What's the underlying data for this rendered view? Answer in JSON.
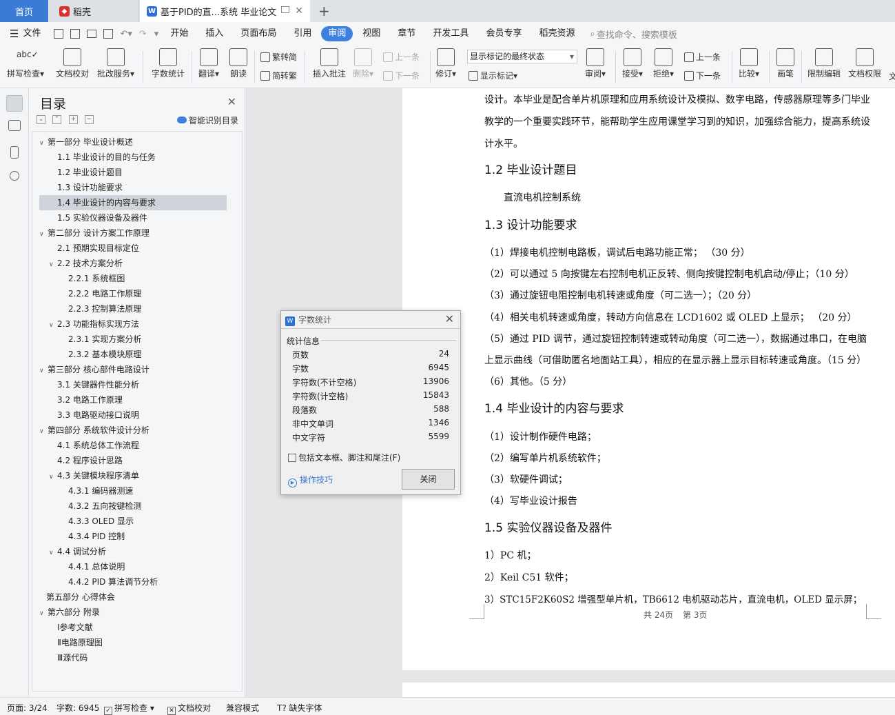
{
  "tabs": {
    "home": "首页",
    "dk": "稻壳",
    "doc": "基于PID的直...系统 毕业论文"
  },
  "menu": {
    "file": "文件",
    "items": [
      "开始",
      "插入",
      "页面布局",
      "引用",
      "审阅",
      "视图",
      "章节",
      "开发工具",
      "会员专享",
      "稻壳资源"
    ],
    "search": "查找命令、搜索模板"
  },
  "ribbon": {
    "spell": "拼写检查",
    "proof": "文档校对",
    "annot": "批改服务",
    "count": "字数统计",
    "translate": "翻译",
    "read": "朗读",
    "to_trad": "繁转简",
    "to_simp": "简转繁",
    "insert_comment": "插入批注",
    "delete": "删除",
    "prev": "上一条",
    "next": "下一条",
    "revise": "修订",
    "markup_select": "显示标记的最终状态",
    "show_markup": "显示标记",
    "review": "审阅",
    "accept": "接受",
    "reject": "拒绝",
    "prev2": "上一条",
    "next2": "下一条",
    "compare": "比较",
    "pen": "画笔",
    "restrict": "限制编辑",
    "perm": "文档权限",
    "more": "文"
  },
  "toc": {
    "title": "目录",
    "smart": "智能识别目录",
    "items": [
      {
        "label": "第一部分  毕业设计概述",
        "tri": "∨"
      },
      {
        "label": "1.1  毕业设计的目的与任务",
        "tri": ""
      },
      {
        "label": "1.2  毕业设计题目",
        "tri": ""
      },
      {
        "label": "1.3  设计功能要求",
        "tri": ""
      },
      {
        "label": "1.4  毕业设计的内容与要求",
        "tri": ""
      },
      {
        "label": "1.5  实验仪器设备及器件",
        "tri": ""
      },
      {
        "label": "第二部分  设计方案工作原理",
        "tri": "∨"
      },
      {
        "label": "2.1  预期实现目标定位",
        "tri": ""
      },
      {
        "label": "2.2  技术方案分析",
        "tri": "∨"
      },
      {
        "label": "2.2.1 系统框图",
        "tri": ""
      },
      {
        "label": "2.2.2 电路工作原理",
        "tri": ""
      },
      {
        "label": "2.2.3 控制算法原理",
        "tri": ""
      },
      {
        "label": "2.3  功能指标实现方法",
        "tri": "∨"
      },
      {
        "label": "2.3.1  实现方案分析",
        "tri": ""
      },
      {
        "label": "2.3.2  基本模块原理",
        "tri": ""
      },
      {
        "label": "第三部分  核心部件电路设计",
        "tri": "∨"
      },
      {
        "label": "3.1  关键器件性能分析",
        "tri": ""
      },
      {
        "label": "3.2  电路工作原理",
        "tri": ""
      },
      {
        "label": "3.3  电路驱动接口说明",
        "tri": ""
      },
      {
        "label": "第四部分  系统软件设计分析",
        "tri": "∨"
      },
      {
        "label": "4.1  系统总体工作流程",
        "tri": ""
      },
      {
        "label": "4.2  程序设计思路",
        "tri": ""
      },
      {
        "label": "4.3  关键模块程序清单",
        "tri": "∨"
      },
      {
        "label": "4.3.1 编码器测速",
        "tri": ""
      },
      {
        "label": "4.3.2 五向按键检测",
        "tri": ""
      },
      {
        "label": "4.3.3 OLED 显示",
        "tri": ""
      },
      {
        "label": "4.3.4 PID 控制",
        "tri": ""
      },
      {
        "label": "4.4  调试分析",
        "tri": "∨"
      },
      {
        "label": "4.4.1  总体说明",
        "tri": ""
      },
      {
        "label": "4.4.2 PID 算法调节分析",
        "tri": ""
      },
      {
        "label": "第五部分  心得体会",
        "tri": ""
      },
      {
        "label": "第六部分  附录",
        "tri": "∨"
      },
      {
        "label": "Ⅰ参考文献",
        "tri": ""
      },
      {
        "label": "Ⅱ电路原理图",
        "tri": ""
      },
      {
        "label": "Ⅲ源代码",
        "tri": ""
      }
    ]
  },
  "doc": {
    "lines": [
      "设计。本毕业是配合单片机原理和应用系统设计及模拟、数字电路，传感器原理等多门毕业",
      "教学的一个重要实践环节，能帮助学生应用课堂学习到的知识，加强综合能力，提高系统设",
      "计水平。"
    ],
    "h12": "1.2  毕业设计题目",
    "topic": "直流电机控制系统",
    "h13": "1.3  设计功能要求",
    "req": [
      "（1）焊接电机控制电路板，调试后电路功能正常；  （30 分）",
      "（2）可以通过  5  向按键左右控制电机正反转、侧向按键控制电机启动/停止；（10 分）",
      "（3）通过旋钮电阻控制电机转速或角度（可二选一）；（20 分）",
      "（4）相关电机转速或角度，转动方向信息在  LCD1602  或  OLED  上显示；  （20 分）",
      "（5）通过  PID  调节，通过旋钮控制转速或转动角度（可二选一），数据通过串口，在电脑",
      "上显示曲线（可借助匿名地面站工具），相应的在显示器上显示目标转速或角度。（15 分）",
      "（6）其他。（5 分）"
    ],
    "h14": "1.4  毕业设计的内容与要求",
    "content": [
      "（1）设计制作硬件电路；",
      "（2）编写单片机系统软件；",
      "（3）软硬件调试；",
      "（4）写毕业设计报告"
    ],
    "h15": "1.5  实验仪器设备及器件",
    "equip": [
      "1）PC 机；",
      "2）Keil C51 软件；",
      "3）STC15F2K60S2 增强型单片机，TB6612 电机驱动芯片，直流电机，OLED 显示屏；"
    ],
    "footer_total": "共 24页",
    "footer_page": "第 3页"
  },
  "dialog": {
    "title": "字数统计",
    "group": "统计信息",
    "stats": [
      {
        "label": "页数",
        "value": "24"
      },
      {
        "label": "字数",
        "value": "6945"
      },
      {
        "label": "字符数(不计空格)",
        "value": "13906"
      },
      {
        "label": "字符数(计空格)",
        "value": "15843"
      },
      {
        "label": "段落数",
        "value": "588"
      },
      {
        "label": "非中文单词",
        "value": "1346"
      },
      {
        "label": "中文字符",
        "value": "5599"
      }
    ],
    "include": "包括文本框、脚注和尾注(F)",
    "tips": "操作技巧",
    "close": "关闭"
  },
  "status": {
    "page": "页面: 3/24",
    "words": "字数: 6945",
    "spell": "拼写检查",
    "proof": "文档校对",
    "compat": "兼容模式",
    "font": "缺失字体"
  }
}
